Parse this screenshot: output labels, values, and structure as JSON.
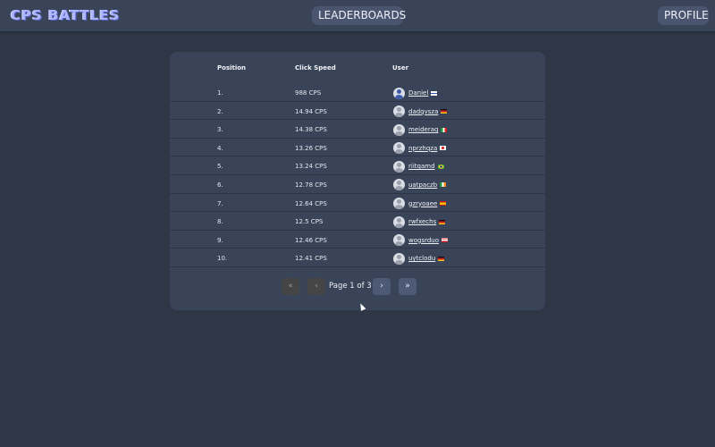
{
  "header": {
    "logo": "CPS BATTLES",
    "nav_leaderboards": "LEADERBOARDS",
    "nav_profile": "PROFILE"
  },
  "table": {
    "columns": [
      "Position",
      "Click Speed",
      "User"
    ],
    "rows": [
      {
        "position": "1.",
        "cps": "988 CPS",
        "user": "Daniel",
        "flag": "finland-flag-icon",
        "avatar": "blue"
      },
      {
        "position": "2.",
        "cps": "14.94 CPS",
        "user": "dadqvsza",
        "flag": "germany-flag-icon",
        "avatar": "default"
      },
      {
        "position": "3.",
        "cps": "14.38 CPS",
        "user": "meideraq",
        "flag": "italy-flag-icon",
        "avatar": "default"
      },
      {
        "position": "4.",
        "cps": "13.26 CPS",
        "user": "nprzhqza",
        "flag": "japan-flag-icon",
        "avatar": "default"
      },
      {
        "position": "5.",
        "cps": "13.24 CPS",
        "user": "riitqamd",
        "flag": "brazil-flag-icon",
        "avatar": "default"
      },
      {
        "position": "6.",
        "cps": "12.78 CPS",
        "user": "uatpaczb",
        "flag": "ireland-flag-icon",
        "avatar": "default"
      },
      {
        "position": "7.",
        "cps": "12.64 CPS",
        "user": "gzryoaee",
        "flag": "spain-flag-icon",
        "avatar": "default"
      },
      {
        "position": "8.",
        "cps": "12.5 CPS",
        "user": "rwfxechs",
        "flag": "germany-flag-icon",
        "avatar": "default"
      },
      {
        "position": "9.",
        "cps": "12.46 CPS",
        "user": "wogsrduo",
        "flag": "usa-flag-icon",
        "avatar": "default"
      },
      {
        "position": "10.",
        "cps": "12.41 CPS",
        "user": "uytclodu",
        "flag": "germany-flag-icon",
        "avatar": "default"
      }
    ]
  },
  "pagination": {
    "first": "«",
    "prev": "‹",
    "label": "Page 1 of 3",
    "next": "›",
    "last": "»"
  },
  "colors": {
    "background": "#2f3747",
    "panel": "#3a4458",
    "logo": "#aab4ff"
  }
}
